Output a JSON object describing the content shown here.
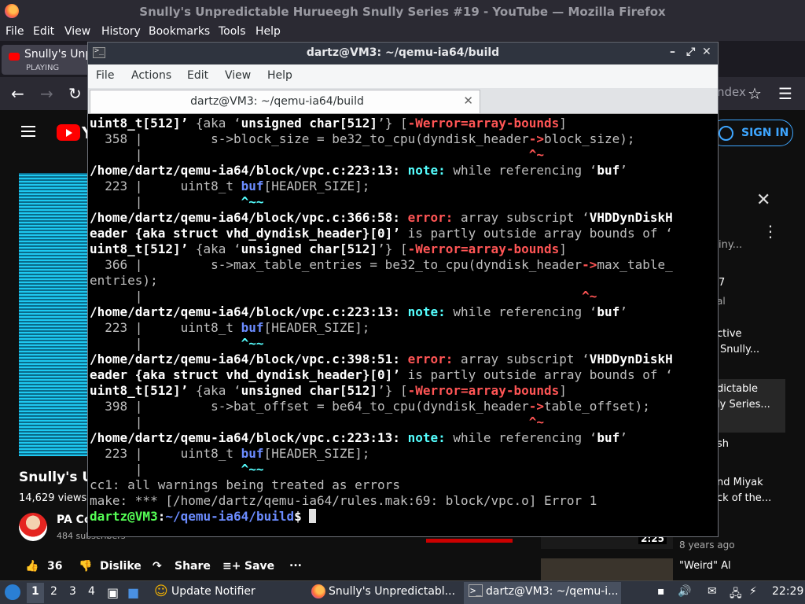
{
  "firefox": {
    "window_title": "Snully's Unpredictable Hurueegh Snully Series #19 - YouTube — Mozilla Firefox",
    "menu": [
      "File",
      "Edit",
      "View",
      "History",
      "Bookmarks",
      "Tools",
      "Help"
    ],
    "tab": {
      "title": "Snully's Unp",
      "status": "PLAYING"
    },
    "url_tail": "ndex"
  },
  "youtube": {
    "logo_letter": "Y",
    "signin_label": "SIGN IN",
    "video_title": "Snully's Ur",
    "views": "14,629 views",
    "channel": "PA Co",
    "subscribers": "484 subscribers",
    "actions": {
      "likes": "36",
      "dislike": "Dislike",
      "share": "Share",
      "save": "Save",
      "more": "..."
    },
    "sidebar": {
      "f1": "iny...",
      "f2": "7",
      "f3": "al",
      "f4a": "ctive",
      "f4b": "Snully...",
      "f5a": "dictable",
      "f5b": "ly Series...",
      "f6": "sh",
      "f7a": "nd Miyak",
      "f7b": "ck of the...",
      "f8": "8 years ago",
      "f9": "\"Weird\" Al",
      "thumb_duration": "2:25"
    }
  },
  "terminal": {
    "title": "dartz@VM3: ~/qemu-ia64/build",
    "menu": [
      "File",
      "Actions",
      "Edit",
      "View",
      "Help"
    ],
    "tab_title": "dartz@VM3: ~/qemu-ia64/build",
    "lines": {
      "l01a": "uint8_t[512]’",
      "l01b": " {aka ‘",
      "l01c": "unsigned char[512]",
      "l01d": "’} [",
      "l01e": "-Werror=array-bounds",
      "l01f": "]",
      "l02a": "  358 |         s->block_size = be32_to_cpu(dyndisk_header",
      "l02b": "->",
      "l02c": "block_size);",
      "l03a": "      |                                                   ",
      "l03b": "^~",
      "l04a": "/home/dartz/qemu-ia64/block/vpc.c:223:13: ",
      "l04b": "note: ",
      "l04c": "while referencing ‘",
      "l04d": "buf",
      "l04e": "’",
      "l05a": "  223 |     uint8_t ",
      "l05b": "buf",
      "l05c": "[HEADER_SIZE];",
      "l06a": "      |             ",
      "l06b": "^~~",
      "l07a": "/home/dartz/qemu-ia64/block/vpc.c:366:58: ",
      "l07b": "error: ",
      "l07c": "array subscript ‘",
      "l07d": "VHDDynDiskH",
      "l08a": "eader {aka struct vhd_dyndisk_header}[0]’",
      "l08b": " is partly outside array bounds of ‘",
      "l09a": "uint8_t[512]’",
      "l09b": " {aka ‘",
      "l09c": "unsigned char[512]",
      "l09d": "’} [",
      "l09e": "-Werror=array-bounds",
      "l09f": "]",
      "l10a": "  366 |         s->max_table_entries = be32_to_cpu(dyndisk_header",
      "l10b": "->",
      "l10c": "max_table_",
      "l11": "entries);",
      "l12a": "      |                                                          ",
      "l12b": "^~",
      "l13a": "/home/dartz/qemu-ia64/block/vpc.c:223:13: ",
      "l13b": "note: ",
      "l13c": "while referencing ‘",
      "l13d": "buf",
      "l13e": "’",
      "l14a": "  223 |     uint8_t ",
      "l14b": "buf",
      "l14c": "[HEADER_SIZE];",
      "l15a": "      |             ",
      "l15b": "^~~",
      "l16a": "/home/dartz/qemu-ia64/block/vpc.c:398:51: ",
      "l16b": "error: ",
      "l16c": "array subscript ‘",
      "l16d": "VHDDynDiskH",
      "l17a": "eader {aka struct vhd_dyndisk_header}[0]’",
      "l17b": " is partly outside array bounds of ‘",
      "l18a": "uint8_t[512]’",
      "l18b": " {aka ‘",
      "l18c": "unsigned char[512]",
      "l18d": "’} [",
      "l18e": "-Werror=array-bounds",
      "l18f": "]",
      "l19a": "  398 |         s->bat_offset = be64_to_cpu(dyndisk_header",
      "l19b": "->",
      "l19c": "table_offset);",
      "l20a": "      |                                                   ",
      "l20b": "^~",
      "l21a": "/home/dartz/qemu-ia64/block/vpc.c:223:13: ",
      "l21b": "note: ",
      "l21c": "while referencing ‘",
      "l21d": "buf",
      "l21e": "’",
      "l22a": "  223 |     uint8_t ",
      "l22b": "buf",
      "l22c": "[HEADER_SIZE];",
      "l23a": "      |             ",
      "l23b": "^~~",
      "l24": "cc1: all warnings being treated as errors",
      "l25": "make: *** [/home/dartz/qemu-ia64/rules.mak:69: block/vpc.o] Error 1",
      "prompt_user": "dartz@VM3",
      "prompt_colon": ":",
      "prompt_path": "~/qemu-ia64/build",
      "prompt_dollar": "$ "
    }
  },
  "taskbar": {
    "workspaces": [
      "1",
      "2",
      "3",
      "4"
    ],
    "tasks": [
      "Update Notifier",
      "Snully's Unpredictabl...",
      "dartz@VM3: ~/qemu-i..."
    ],
    "clock": "22:29"
  }
}
